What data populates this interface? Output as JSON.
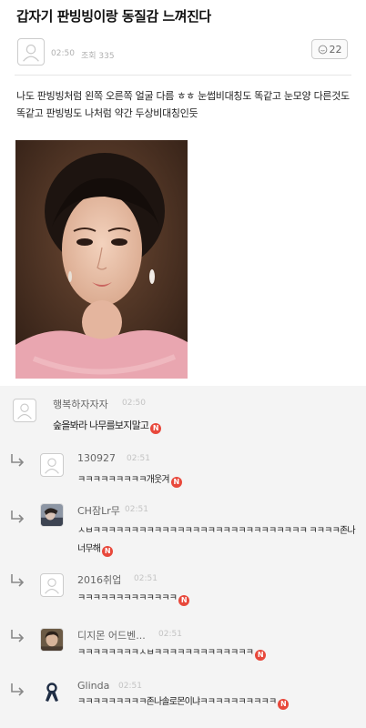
{
  "post": {
    "title": "갑자기 판빙빙이랑 동질감 느껴진다",
    "time": "02:50",
    "views": "조회 335",
    "comment_count": "22",
    "body_text": "나도 판빙빙처럼 왼쪽 오른쪽 얼굴 다름 ㅎㅎ 눈썹비대칭도 똑같고 눈모양 다른것도 똑같고 판빙빙도 나처럼 약간 두상비대칭인듯"
  },
  "comments": [
    {
      "name": "행복하자자자",
      "time": "02:50",
      "text": "숲을봐라 나무를보지말고",
      "reply": false,
      "avatar_icon": "default-user-icon"
    },
    {
      "name": "130927",
      "time": "02:51",
      "text": "ㅋㅋㅋㅋㅋㅋㅋㅋㅋ개웃겨",
      "reply": true,
      "avatar_icon": "default-user-icon"
    },
    {
      "name": "CH잠Lr무",
      "time": "02:51",
      "text": "ㅅㅂㅋㅋㅋㅋㅋㅋㅋㅋㅋㅋㅋㅋㅋㅋㅋㅋㅋㅋㅋㅋㅋㅋㅋㅋㅋㅋㅋㅋ ㅋㅋㅋㅋ존나 너무해",
      "reply": true,
      "avatar_icon": "profile-photo"
    },
    {
      "name": "2016취업",
      "time": "02:51",
      "text": "ㅋㅋㅋㅋㅋㅋㅋㅋㅋㅋㅋㅋㅋ",
      "reply": true,
      "avatar_icon": "default-user-icon"
    },
    {
      "name": "디지몬 어드벤...",
      "time": "02:51",
      "text": "ㅋㅋㅋㅋㅋㅋㅋㅋㅅㅂㅋㅋㅋㅋㅋㅋㅋㅋㅋㅋㅋㅋㅋ",
      "reply": true,
      "avatar_icon": "profile-photo"
    },
    {
      "name": "Glinda",
      "time": "02:51",
      "text": "ㅋㅋㅋㅋㅋㅋㅋㅋㅋ존나솔로몬이냐ㅋㅋㅋㅋㅋㅋㅋㅋㅋㅋ",
      "reply": true,
      "avatar_icon": "ribbon-icon"
    }
  ],
  "new_badge": "N",
  "colors": {
    "badge": "#e8483b",
    "muted": "#b0b0b0",
    "border": "#cccccc",
    "background": "#f4f4f4"
  }
}
